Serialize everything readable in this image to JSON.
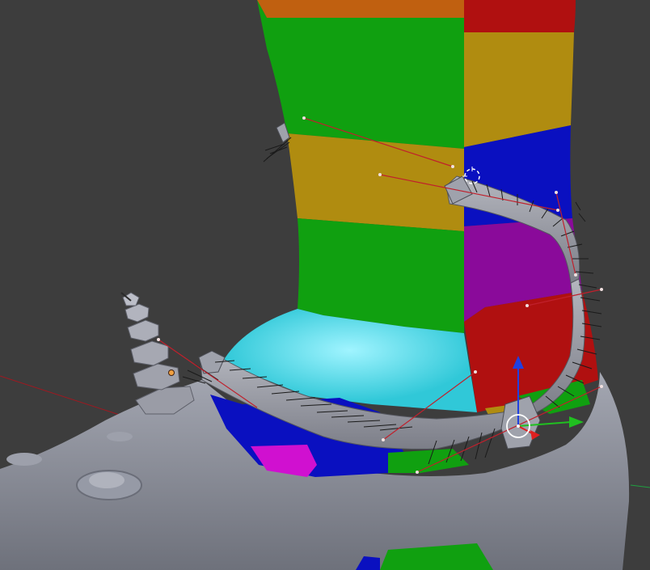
{
  "viewport": {
    "background_color": "#3d3d3d"
  },
  "mesh_colors": {
    "green": "#10a010",
    "olive": "#b08c10",
    "orange": "#c06010",
    "red": "#b01010",
    "blue": "#0a10c0",
    "purple": "#8a0a9a",
    "cyan": "#30c8d8",
    "magenta": "#d010d0",
    "grey_shoe": "#8a8d98"
  },
  "curve_colors": {
    "handle_line": "#c0202c",
    "hair_strand": "#1a1a1a",
    "vertex_dot": "#f0e0e0",
    "selected_vertex": "#f0a040"
  },
  "gizmo": {
    "x_axis_color": "#e02020",
    "y_axis_color": "#20c020",
    "z_axis_color": "#2040e0",
    "cursor_icon": "3d-cursor-icon",
    "center_icon": "transform-center-icon"
  }
}
